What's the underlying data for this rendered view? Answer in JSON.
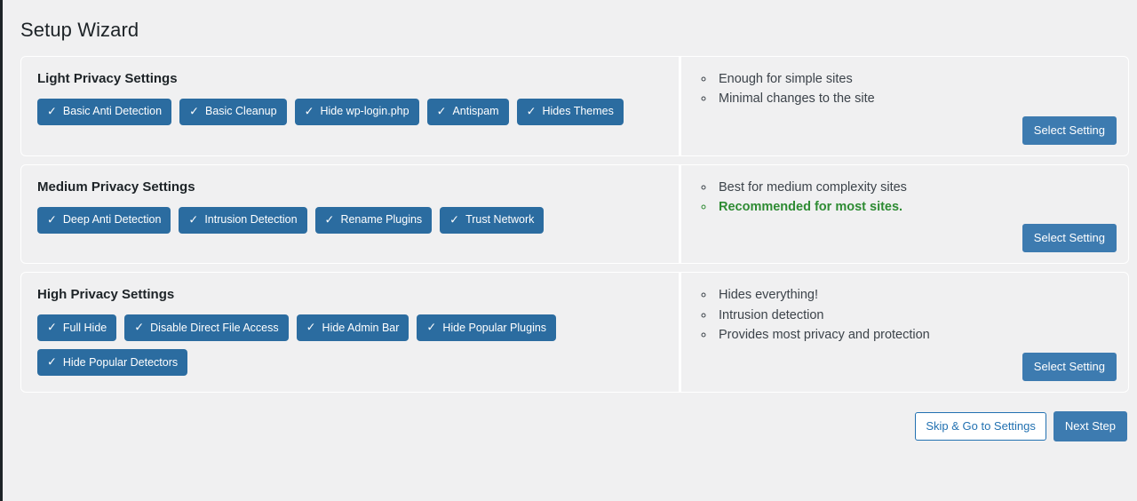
{
  "page": {
    "title": "Setup Wizard",
    "background_color": "#f0f0f1",
    "accent_color": "#2b6ca0",
    "button_color": "#3d7bb0",
    "recommend_color": "#2e8b33"
  },
  "check_icon": "✓",
  "cards": [
    {
      "title": "Light Privacy Settings",
      "badges": [
        {
          "label": "Basic Anti Detection"
        },
        {
          "label": "Basic Cleanup"
        },
        {
          "label": "Hide wp-login.php"
        },
        {
          "label": "Antispam"
        },
        {
          "label": "Hides Themes"
        }
      ],
      "bullets": [
        {
          "text": "Enough for simple sites",
          "highlight": false
        },
        {
          "text": "Minimal changes to the site",
          "highlight": false
        }
      ],
      "select_label": "Select Setting"
    },
    {
      "title": "Medium Privacy Settings",
      "badges": [
        {
          "label": "Deep Anti Detection"
        },
        {
          "label": "Intrusion Detection"
        },
        {
          "label": "Rename Plugins"
        },
        {
          "label": "Trust Network"
        }
      ],
      "bullets": [
        {
          "text": "Best for medium complexity sites",
          "highlight": false
        },
        {
          "text": "Recommended for most sites.",
          "highlight": true
        }
      ],
      "select_label": "Select Setting"
    },
    {
      "title": "High Privacy Settings",
      "badges": [
        {
          "label": "Full Hide"
        },
        {
          "label": "Disable Direct File Access"
        },
        {
          "label": "Hide Admin Bar"
        },
        {
          "label": "Hide Popular Plugins"
        },
        {
          "label": "Hide Popular Detectors"
        }
      ],
      "bullets": [
        {
          "text": "Hides everything!",
          "highlight": false
        },
        {
          "text": "Intrusion detection",
          "highlight": false
        },
        {
          "text": "Provides most privacy and protection",
          "highlight": false
        }
      ],
      "select_label": "Select Setting"
    }
  ],
  "footer": {
    "skip_label": "Skip & Go to Settings",
    "next_label": "Next Step"
  }
}
